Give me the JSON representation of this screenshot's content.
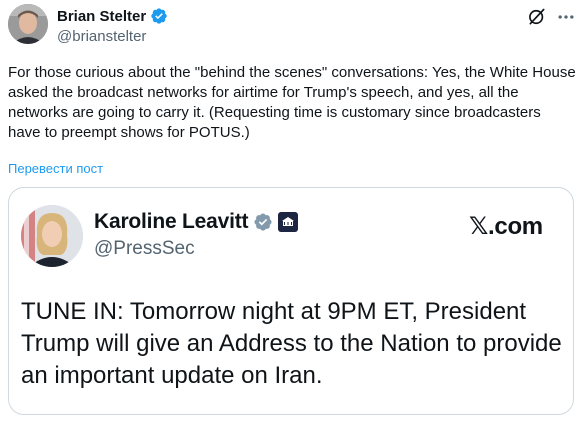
{
  "author": {
    "display_name": "Brian Stelter",
    "handle": "@brianstelter"
  },
  "post": {
    "text": "For those curious about the \"behind the scenes\" conversations: Yes, the White House asked the broadcast networks for airtime for Trump's speech, and yes, all the networks are going to carry it. (Requesting time is customary since broadcasters have to preempt shows for POTUS.)",
    "translate_label": "Перевести пост"
  },
  "card": {
    "display_name": "Karoline Leavitt",
    "handle": "@PressSec",
    "domain": "𝕏.com",
    "body": "TUNE IN: Tomorrow night at 9PM ET, President Trump will give an Address to the Nation to provide an important update on Iran."
  },
  "colors": {
    "accent": "#1d9bf0",
    "verified_blue": "#1d9bf0",
    "verified_grey": "#829aab",
    "text_primary": "#0f1419",
    "text_secondary": "#536471",
    "border": "#cfd9de"
  },
  "icons": [
    "verified-badge-icon",
    "grok-icon",
    "more-icon",
    "government-verified-icon",
    "white-house-affiliate-icon"
  ]
}
